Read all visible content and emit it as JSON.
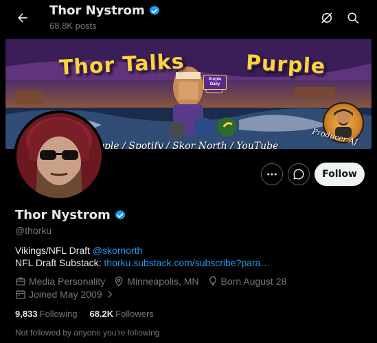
{
  "header": {
    "name": "Thor Nystrom",
    "posts": "68.8K posts"
  },
  "banner": {
    "title_left": "Thor Talks",
    "title_right": "Purple",
    "tagline": "pple / Spotify / Skor North / YouTube",
    "badge_text": "Purple Daily",
    "producer_label": "Producer AJ"
  },
  "actions": {
    "follow_label": "Follow"
  },
  "profile": {
    "name": "Thor Nystrom",
    "handle": "@thorku",
    "bio_line1_text": "Vikings/NFL Draft ",
    "bio_line1_mention": "@skornorth",
    "bio_line2_text": "NFL Draft Substack: ",
    "bio_line2_link": "thorku.substack.com/subscribe?para…",
    "category": "Media Personality",
    "location": "Minneapolis, MN",
    "birthday": "Born August 28",
    "joined": "Joined May 2009",
    "following_count": "9,833",
    "following_label": "Following",
    "followers_count": "68.2K",
    "followers_label": "Followers",
    "followed_note": "Not followed by anyone you're following"
  },
  "colors": {
    "background": "#000000",
    "text": "#e7e9ea",
    "muted": "#71767b",
    "link": "#1d9bf0",
    "verified": "#1d9bf0",
    "follow_button_bg": "#eff3f4"
  }
}
